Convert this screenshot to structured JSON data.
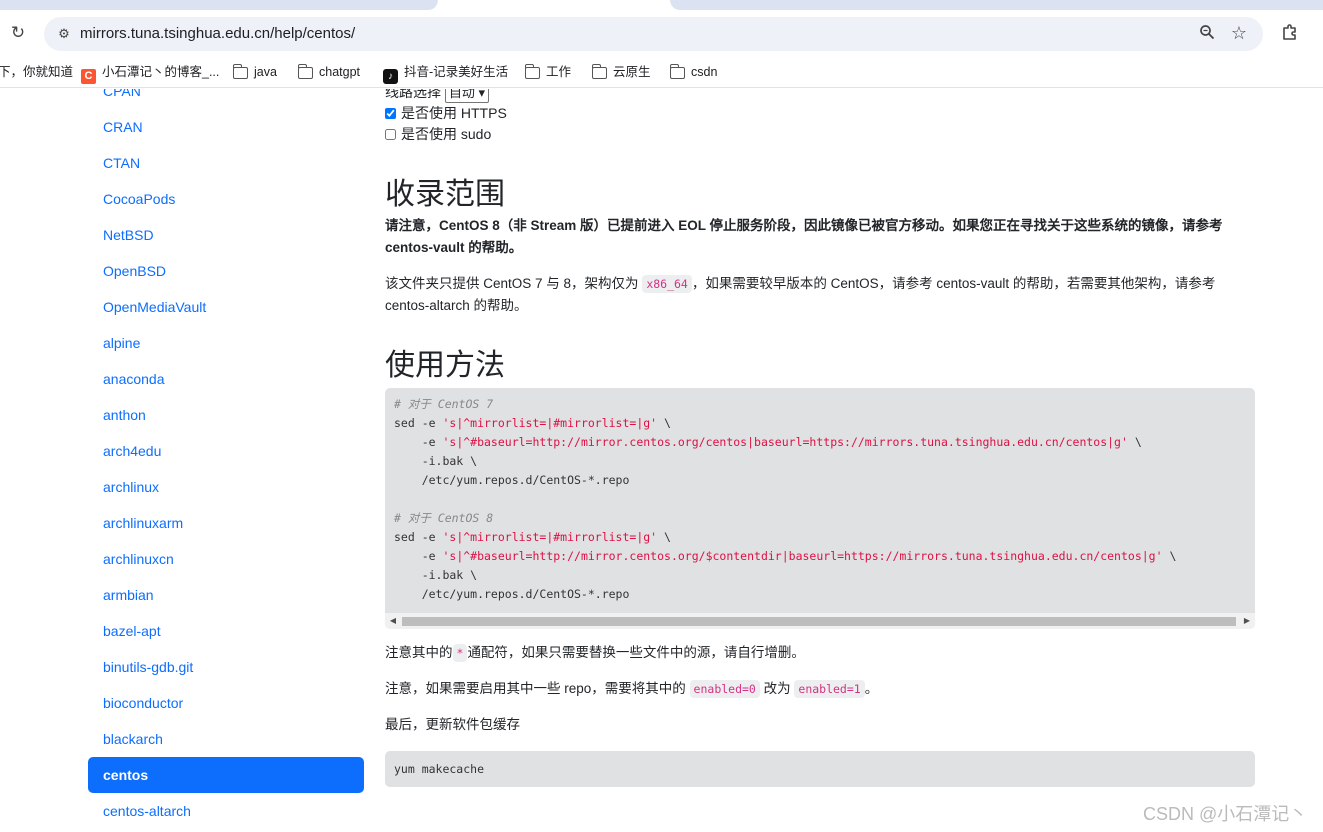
{
  "browser": {
    "url": "mirrors.tuna.tsinghua.edu.cn/help/centos/",
    "bookmarks": [
      {
        "label": "下，你就知道",
        "icon": "none"
      },
      {
        "label": "小石潭记丶的博客_...",
        "icon": "csdn-icon"
      },
      {
        "label": "java",
        "icon": "folder-icon"
      },
      {
        "label": "chatgpt",
        "icon": "folder-icon"
      },
      {
        "label": "抖音-记录美好生活",
        "icon": "tiktok-icon"
      },
      {
        "label": "工作",
        "icon": "folder-icon"
      },
      {
        "label": "云原生",
        "icon": "folder-icon"
      },
      {
        "label": "csdn",
        "icon": "folder-icon"
      }
    ]
  },
  "sidebar": {
    "items": [
      "CPAN",
      "CRAN",
      "CTAN",
      "CocoaPods",
      "NetBSD",
      "OpenBSD",
      "OpenMediaVault",
      "alpine",
      "anaconda",
      "anthon",
      "arch4edu",
      "archlinux",
      "archlinuxarm",
      "archlinuxcn",
      "armbian",
      "bazel-apt",
      "binutils-gdb.git",
      "bioconductor",
      "blackarch",
      "centos",
      "centos-altarch"
    ],
    "active": "centos"
  },
  "form": {
    "line_label": "线路选择",
    "line_value": "自动",
    "https_label": "是否使用 HTTPS",
    "https_checked": true,
    "sudo_label": "是否使用 sudo",
    "sudo_checked": false
  },
  "scope": {
    "heading": "收录范围",
    "note": "请注意，CentOS 8（非 Stream 版）已提前进入 EOL 停止服务阶段，因此镜像已被官方移动。如果您正在寻找关于这些系统的镜像，请参考 centos-vault 的帮助。",
    "desc_pre": "该文件夹只提供 CentOS 7 与 8，架构仅为",
    "desc_code": "x86_64",
    "desc_post": "，如果需要较早版本的 CentOS，请参考 centos-vault 的帮助，若需要其他架构，请参考 centos-altarch 的帮助。"
  },
  "usage": {
    "heading": "使用方法",
    "code_lines": [
      {
        "type": "comment",
        "text": "# 对于 CentOS 7"
      },
      {
        "type": "cmd",
        "pre": "sed -e ",
        "str": "'s|^mirrorlist=|#mirrorlist=|g'",
        "post": " \\"
      },
      {
        "type": "cmd",
        "pre": "    -e ",
        "str": "'s|^#baseurl=http://mirror.centos.org/centos|baseurl=https://mirrors.tuna.tsinghua.edu.cn/centos|g'",
        "post": " \\"
      },
      {
        "type": "plain",
        "text": "    -i.bak \\"
      },
      {
        "type": "plain",
        "text": "    /etc/yum.repos.d/CentOS-*.repo"
      },
      {
        "type": "plain",
        "text": ""
      },
      {
        "type": "comment",
        "text": "# 对于 CentOS 8"
      },
      {
        "type": "cmd",
        "pre": "sed -e ",
        "str": "'s|^mirrorlist=|#mirrorlist=|g'",
        "post": " \\"
      },
      {
        "type": "cmd",
        "pre": "    -e ",
        "str": "'s|^#baseurl=http://mirror.centos.org/$contentdir|baseurl=https://mirrors.tuna.tsinghua.edu.cn/centos|g'",
        "post": " \\"
      },
      {
        "type": "plain",
        "text": "    -i.bak \\"
      },
      {
        "type": "plain",
        "text": "    /etc/yum.repos.d/CentOS-*.repo"
      }
    ],
    "note1_pre": "注意其中的",
    "note1_code": "*",
    "note1_post": "通配符，如果只需要替换一些文件中的源，请自行增删。",
    "note2_pre": "注意，如果需要启用其中一些 repo，需要将其中的",
    "note2_code1": "enabled=0",
    "note2_mid": "改为",
    "note2_code2": "enabled=1",
    "note2_post": "。",
    "note3": "最后，更新软件包缓存",
    "makecache": "yum makecache"
  },
  "watermark": "CSDN @小石潭记丶"
}
